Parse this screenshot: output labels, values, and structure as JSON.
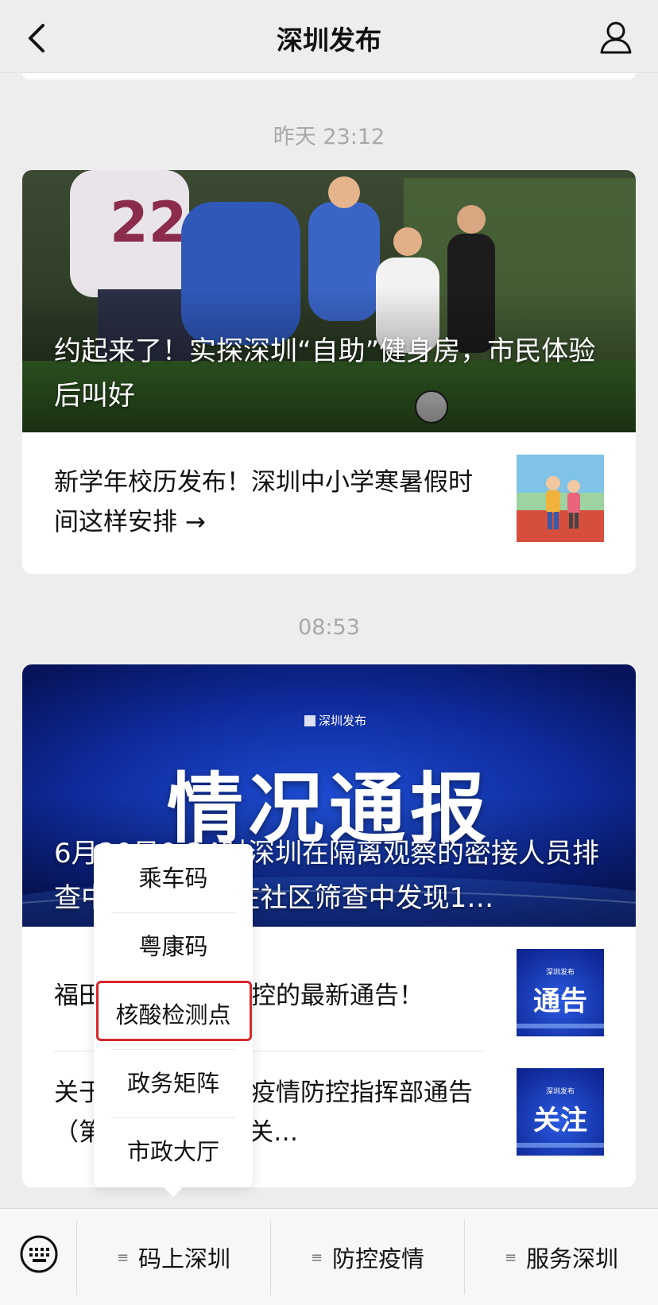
{
  "header": {
    "title": "深圳发布",
    "back_icon": "chevron-left-icon",
    "profile_icon": "person-icon"
  },
  "timestamps": [
    "昨天 23:12",
    "08:53"
  ],
  "card1": {
    "hero_title": "约起来了！实探深圳“自助”健身房，市民体验后叫好",
    "items": [
      {
        "title": "新学年校历发布！深圳中小学寒暑假时间这样安排 →"
      }
    ]
  },
  "card2": {
    "hero": {
      "brand": "深圳发布",
      "headline": "情况通报",
      "title": "6月20日0-24时深圳在隔离观察的密接人员排查中发现2例，在社区筛查中发现1…"
    },
    "items": [
      {
        "title": "福田区关于疫情防控的最新通告！",
        "thumb_text": "通告",
        "thumb_brand": "深圳发布"
      },
      {
        "title": "关于新冠病毒肺炎疫情防控指挥部通告（第188号）的有关…",
        "thumb_text": "关注",
        "thumb_brand": "深圳发布"
      }
    ]
  },
  "popup_menu": {
    "items": [
      "乘车码",
      "粤康码",
      "核酸检测点",
      "政务矩阵",
      "市政大厅"
    ],
    "highlighted_index": 2,
    "highlight_color": "#d9262c"
  },
  "bottom_bar": {
    "keyboard_icon": "keyboard-icon",
    "tabs": [
      "码上深圳",
      "防控疫情",
      "服务深圳"
    ],
    "menu_icon": "≡"
  },
  "colors": {
    "background": "#ededed",
    "timestamp": "#a8a8a8",
    "news_blue": "#0b2a9e"
  }
}
